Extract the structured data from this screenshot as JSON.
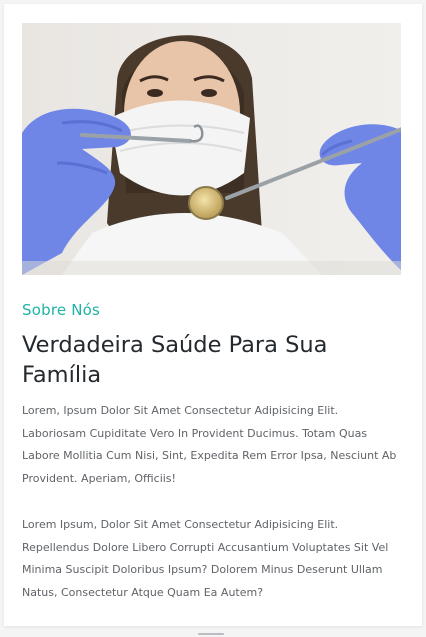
{
  "about": {
    "image_alt": "Dentista segurando instrumentos odontológicos",
    "eyebrow": "Sobre Nós",
    "title": "Verdadeira Saúde Para Sua Família",
    "paragraphs": [
      "Lorem, Ipsum Dolor Sit Amet Consectetur Adipisicing Elit. Laboriosam Cupiditate Vero In Provident Ducimus. Totam Quas Labore Mollitia Cum Nisi, Sint, Expedita Rem Error Ipsa, Nesciunt Ab Provident. Aperiam, Officiis!",
      "Lorem Ipsum, Dolor Sit Amet Consectetur Adipisicing Elit. Repellendus Dolore Libero Corrupti Accusantium Voluptates Sit Vel Minima Suscipit Doloribus Ipsum? Dolorem Minus Deserunt Ullam Natus, Consectetur Atque Quam Ea Autem?"
    ]
  },
  "colors": {
    "accent": "#1fb3a6",
    "heading": "#24292e",
    "body_text": "#5f6368",
    "glove": "#6f86e6"
  }
}
